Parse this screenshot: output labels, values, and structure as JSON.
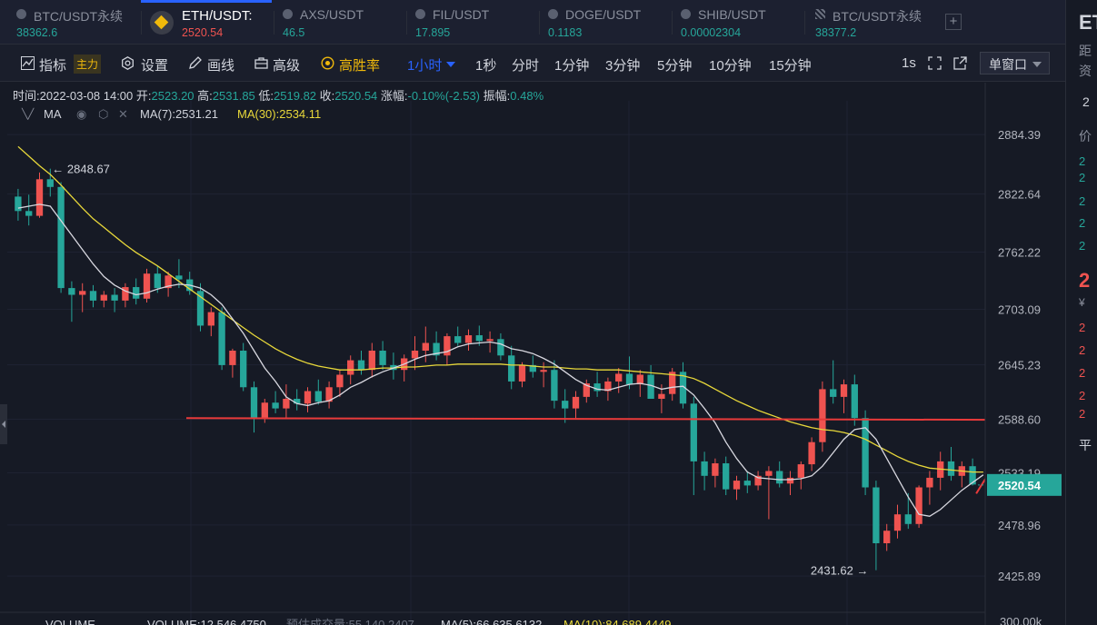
{
  "tabs": [
    {
      "name": "BTC/USDT永续",
      "price": "38362.6"
    },
    {
      "name": "ETH/USDT:",
      "price": "2520.54"
    },
    {
      "name": "AXS/USDT",
      "price": "46.5"
    },
    {
      "name": "FIL/USDT",
      "price": "17.895"
    },
    {
      "name": "DOGE/USDT",
      "price": "0.1183"
    },
    {
      "name": "SHIB/USDT",
      "price": "0.00002304"
    },
    {
      "name": "BTC/USDT永续",
      "price": "38377.2"
    }
  ],
  "add_tab_label": "+",
  "toolbar": {
    "indicator": "指标",
    "main_badge": "主力",
    "settings": "设置",
    "draw": "画线",
    "advanced": "高级",
    "winrate": "高胜率",
    "interval": "1小时",
    "intervals": [
      "1秒",
      "分时",
      "1分钟",
      "3分钟",
      "5分钟",
      "10分钟",
      "15分钟"
    ],
    "refresh": "1s",
    "window_mode": "单窗口"
  },
  "ohlc": {
    "time_label": "时间:",
    "time": "2022-03-08 14:00",
    "open_label": "开:",
    "open": "2523.20",
    "high_label": "高:",
    "high": "2531.85",
    "low_label": "低:",
    "low": "2519.82",
    "close_label": "收:",
    "close": "2520.54",
    "change_label": "涨幅:",
    "change": "-0.10%(-2.53)",
    "amp_label": "振幅:",
    "amp": "0.48%"
  },
  "ma_legend": {
    "label": "MA",
    "ma7": "MA(7):2531.21",
    "ma30": "MA(30):2534.11"
  },
  "volume_legend": {
    "label": "VOLUME",
    "volume": "VOLUME:12,546.4750",
    "est": "预估成交量:55,140.2407",
    "ma5": "MA(5):66,635.6132",
    "ma10": "MA(10):84,689.4449"
  },
  "annotations": {
    "high_marker": "← 2848.67",
    "low_marker": "2431.62 →"
  },
  "colors": {
    "up": "#ef5350",
    "down": "#26a69a",
    "ma7": "#d8d8e0",
    "ma30": "#e8d83a",
    "drawing": "#e83a3a",
    "accent": "#2962ff",
    "gold": "#f0b90b"
  },
  "chart_data": {
    "type": "candlestick",
    "symbol": "ETH/USDT",
    "interval": "1小时",
    "price_axis_ticks": [
      "2884.39",
      "2822.64",
      "2762.22",
      "2703.09",
      "2645.23",
      "2588.60",
      "2533.19",
      "2478.96",
      "2425.89"
    ],
    "volume_axis_tick": "300.00k",
    "current_price": "2520.54",
    "ylim": [
      2410,
      2910
    ],
    "candles": [
      [
        2820,
        2828,
        2795,
        2805
      ],
      [
        2805,
        2822,
        2790,
        2800
      ],
      [
        2800,
        2845,
        2798,
        2838
      ],
      [
        2838,
        2849,
        2820,
        2830
      ],
      [
        2830,
        2835,
        2720,
        2725
      ],
      [
        2725,
        2732,
        2690,
        2718
      ],
      [
        2718,
        2730,
        2700,
        2722
      ],
      [
        2722,
        2728,
        2705,
        2712
      ],
      [
        2712,
        2722,
        2705,
        2718
      ],
      [
        2718,
        2725,
        2700,
        2712
      ],
      [
        2712,
        2730,
        2705,
        2726
      ],
      [
        2726,
        2735,
        2708,
        2714
      ],
      [
        2714,
        2745,
        2710,
        2740
      ],
      [
        2740,
        2748,
        2720,
        2725
      ],
      [
        2725,
        2742,
        2716,
        2738
      ],
      [
        2738,
        2755,
        2725,
        2734
      ],
      [
        2734,
        2742,
        2718,
        2722
      ],
      [
        2722,
        2730,
        2680,
        2686
      ],
      [
        2686,
        2705,
        2675,
        2700
      ],
      [
        2700,
        2705,
        2640,
        2645
      ],
      [
        2645,
        2662,
        2632,
        2660
      ],
      [
        2660,
        2668,
        2618,
        2622
      ],
      [
        2622,
        2628,
        2575,
        2590
      ],
      [
        2590,
        2610,
        2585,
        2606
      ],
      [
        2606,
        2618,
        2595,
        2600
      ],
      [
        2600,
        2625,
        2590,
        2610
      ],
      [
        2610,
        2620,
        2598,
        2605
      ],
      [
        2605,
        2622,
        2596,
        2618
      ],
      [
        2618,
        2630,
        2604,
        2607
      ],
      [
        2607,
        2628,
        2600,
        2622
      ],
      [
        2622,
        2640,
        2612,
        2635
      ],
      [
        2635,
        2655,
        2625,
        2650
      ],
      [
        2650,
        2660,
        2635,
        2640
      ],
      [
        2640,
        2668,
        2632,
        2660
      ],
      [
        2660,
        2670,
        2640,
        2645
      ],
      [
        2645,
        2658,
        2630,
        2640
      ],
      [
        2640,
        2656,
        2628,
        2652
      ],
      [
        2652,
        2675,
        2640,
        2660
      ],
      [
        2660,
        2685,
        2648,
        2668
      ],
      [
        2668,
        2680,
        2650,
        2655
      ],
      [
        2655,
        2678,
        2645,
        2675
      ],
      [
        2675,
        2685,
        2665,
        2668
      ],
      [
        2668,
        2682,
        2660,
        2676
      ],
      [
        2676,
        2686,
        2665,
        2670
      ],
      [
        2670,
        2680,
        2658,
        2672
      ],
      [
        2672,
        2678,
        2650,
        2655
      ],
      [
        2655,
        2665,
        2620,
        2628
      ],
      [
        2628,
        2648,
        2622,
        2645
      ],
      [
        2645,
        2655,
        2632,
        2638
      ],
      [
        2638,
        2648,
        2622,
        2640
      ],
      [
        2640,
        2650,
        2600,
        2608
      ],
      [
        2608,
        2620,
        2585,
        2600
      ],
      [
        2600,
        2618,
        2590,
        2612
      ],
      [
        2612,
        2630,
        2606,
        2626
      ],
      [
        2626,
        2638,
        2612,
        2618
      ],
      [
        2618,
        2632,
        2608,
        2628
      ],
      [
        2628,
        2642,
        2616,
        2636
      ],
      [
        2636,
        2654,
        2620,
        2625
      ],
      [
        2625,
        2640,
        2612,
        2635
      ],
      [
        2635,
        2645,
        2620,
        2610
      ],
      [
        2610,
        2625,
        2595,
        2615
      ],
      [
        2615,
        2642,
        2608,
        2638
      ],
      [
        2638,
        2648,
        2600,
        2605
      ],
      [
        2605,
        2612,
        2510,
        2545
      ],
      [
        2545,
        2555,
        2515,
        2530
      ],
      [
        2530,
        2548,
        2518,
        2543
      ],
      [
        2543,
        2550,
        2510,
        2516
      ],
      [
        2516,
        2530,
        2505,
        2525
      ],
      [
        2525,
        2535,
        2512,
        2520
      ],
      [
        2520,
        2535,
        2515,
        2530
      ],
      [
        2530,
        2540,
        2485,
        2535
      ],
      [
        2535,
        2545,
        2518,
        2522
      ],
      [
        2522,
        2535,
        2510,
        2528
      ],
      [
        2528,
        2545,
        2516,
        2542
      ],
      [
        2542,
        2570,
        2535,
        2565
      ],
      [
        2565,
        2628,
        2555,
        2620
      ],
      [
        2620,
        2650,
        2605,
        2612
      ],
      [
        2612,
        2630,
        2595,
        2625
      ],
      [
        2625,
        2635,
        2582,
        2590
      ],
      [
        2590,
        2598,
        2510,
        2518
      ],
      [
        2518,
        2525,
        2432,
        2460
      ],
      [
        2460,
        2480,
        2452,
        2473
      ],
      [
        2473,
        2500,
        2465,
        2490
      ],
      [
        2490,
        2512,
        2475,
        2480
      ],
      [
        2480,
        2520,
        2476,
        2518
      ],
      [
        2518,
        2535,
        2500,
        2528
      ],
      [
        2528,
        2555,
        2515,
        2545
      ],
      [
        2545,
        2560,
        2525,
        2530
      ],
      [
        2530,
        2545,
        2518,
        2540
      ],
      [
        2540,
        2548,
        2520,
        2521
      ]
    ],
    "ma7": [
      2808,
      2810,
      2812,
      2810,
      2795,
      2780,
      2765,
      2750,
      2737,
      2728,
      2722,
      2718,
      2720,
      2724,
      2727,
      2729,
      2728,
      2725,
      2718,
      2708,
      2693,
      2678,
      2660,
      2642,
      2628,
      2612,
      2605,
      2603,
      2606,
      2608,
      2614,
      2622,
      2627,
      2633,
      2638,
      2642,
      2646,
      2651,
      2655,
      2657,
      2659,
      2664,
      2667,
      2668,
      2669,
      2667,
      2662,
      2660,
      2657,
      2652,
      2646,
      2638,
      2630,
      2624,
      2620,
      2619,
      2622,
      2625,
      2626,
      2624,
      2620,
      2622,
      2623,
      2614,
      2600,
      2585,
      2565,
      2548,
      2534,
      2528,
      2527,
      2526,
      2526,
      2527,
      2530,
      2540,
      2554,
      2568,
      2578,
      2580,
      2568,
      2548,
      2528,
      2508,
      2490,
      2488,
      2495,
      2505,
      2515,
      2523,
      2531
    ],
    "ma30": [
      2872,
      2862,
      2852,
      2843,
      2832,
      2820,
      2808,
      2797,
      2788,
      2779,
      2770,
      2762,
      2755,
      2748,
      2740,
      2732,
      2724,
      2716,
      2708,
      2700,
      2692,
      2684,
      2676,
      2669,
      2662,
      2656,
      2651,
      2647,
      2644,
      2642,
      2640,
      2640,
      2640,
      2641,
      2642,
      2642,
      2643,
      2643,
      2644,
      2645,
      2645,
      2646,
      2646,
      2646,
      2646,
      2646,
      2645,
      2645,
      2644,
      2643,
      2643,
      2642,
      2641,
      2641,
      2640,
      2640,
      2640,
      2639,
      2638,
      2637,
      2636,
      2635,
      2634,
      2631,
      2626,
      2620,
      2614,
      2608,
      2603,
      2598,
      2594,
      2590,
      2586,
      2583,
      2580,
      2578,
      2577,
      2575,
      2572,
      2568,
      2562,
      2556,
      2550,
      2545,
      2541,
      2538,
      2537,
      2536,
      2535,
      2534,
      2534
    ],
    "horizontal_line": 2589
  }
}
